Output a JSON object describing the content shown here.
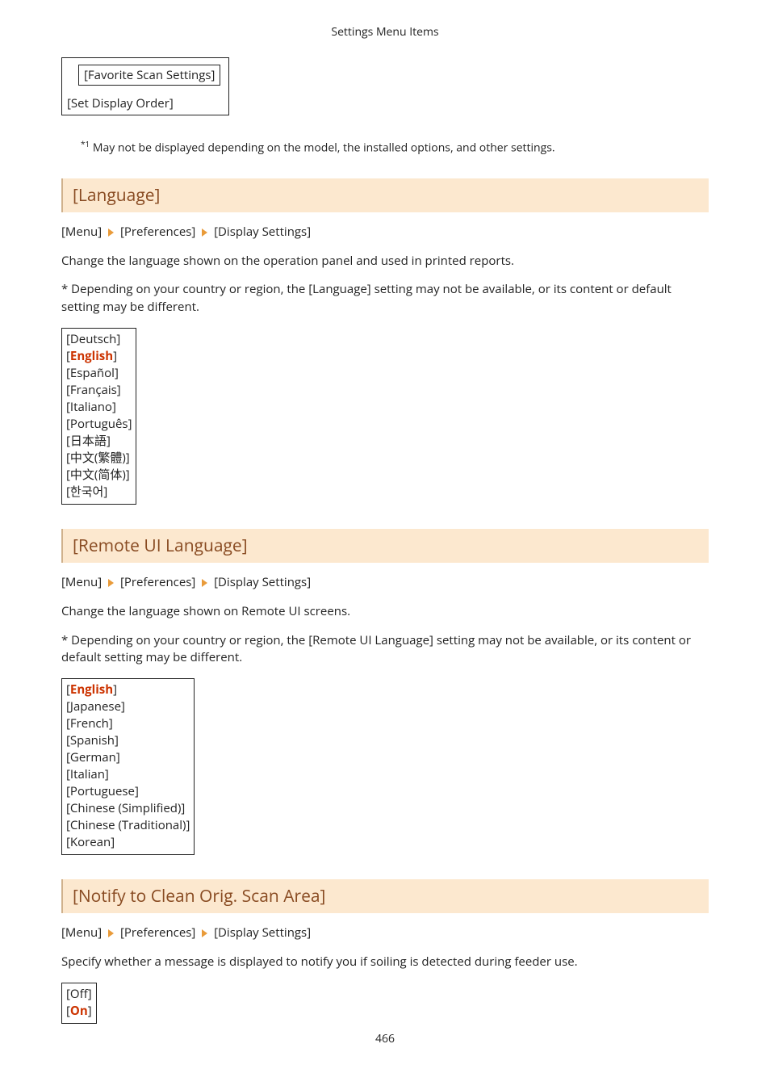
{
  "header": "Settings Menu Items",
  "topBox": {
    "inner": "[Favorite Scan Settings]",
    "outer": "[Set Display Order]"
  },
  "footnote": {
    "marker": "*1",
    "text": " May not be displayed depending on the model, the installed options, and other settings."
  },
  "breadcrumb": {
    "a": "[Menu]",
    "b": "[Preferences]",
    "c": "[Display Settings]"
  },
  "sections": {
    "language": {
      "title": "[Language]",
      "desc": "Change the language shown on the operation panel and used in printed reports.",
      "note": "* Depending on your country or region, the [Language] setting may not be available, or its content or default setting may be different.",
      "options": [
        {
          "pre": "[",
          "val": "Deutsch",
          "post": "]",
          "hl": false
        },
        {
          "pre": "[",
          "val": "English",
          "post": "]",
          "hl": true
        },
        {
          "pre": "[",
          "val": "Español",
          "post": "]",
          "hl": false
        },
        {
          "pre": "[",
          "val": "Français",
          "post": "]",
          "hl": false
        },
        {
          "pre": "[",
          "val": "Italiano",
          "post": "]",
          "hl": false
        },
        {
          "pre": "[",
          "val": "Português",
          "post": "]",
          "hl": false
        },
        {
          "pre": "[",
          "val": "日本語",
          "post": "]",
          "hl": false
        },
        {
          "pre": "[",
          "val": "中文(繁體)",
          "post": "]",
          "hl": false
        },
        {
          "pre": "[",
          "val": "中文(简体)",
          "post": "]",
          "hl": false
        },
        {
          "pre": "[",
          "val": "한국어",
          "post": "]",
          "hl": false
        }
      ]
    },
    "remote": {
      "title": "[Remote UI Language]",
      "desc": "Change the language shown on Remote UI screens.",
      "note": "* Depending on your country or region, the [Remote UI Language] setting may not be available, or its content or default setting may be different.",
      "options": [
        {
          "pre": "[",
          "val": "English",
          "post": "]",
          "hl": true
        },
        {
          "pre": "[",
          "val": "Japanese",
          "post": "]",
          "hl": false
        },
        {
          "pre": "[",
          "val": "French",
          "post": "]",
          "hl": false
        },
        {
          "pre": "[",
          "val": "Spanish",
          "post": "]",
          "hl": false
        },
        {
          "pre": "[",
          "val": "German",
          "post": "]",
          "hl": false
        },
        {
          "pre": "[",
          "val": "Italian",
          "post": "]",
          "hl": false
        },
        {
          "pre": "[",
          "val": "Portuguese",
          "post": "]",
          "hl": false
        },
        {
          "pre": "[",
          "val": "Chinese (Simplified)",
          "post": "]",
          "hl": false
        },
        {
          "pre": "[",
          "val": "Chinese (Traditional)",
          "post": "]",
          "hl": false
        },
        {
          "pre": "[",
          "val": "Korean",
          "post": "]",
          "hl": false
        }
      ]
    },
    "notify": {
      "title": "[Notify to Clean Orig. Scan Area]",
      "desc": "Specify whether a message is displayed to notify you if soiling is detected during feeder use.",
      "options": [
        {
          "pre": "[",
          "val": "Off",
          "post": "]",
          "hl": false
        },
        {
          "pre": "[",
          "val": "On",
          "post": "]",
          "hl": true
        }
      ]
    }
  },
  "pageNumber": "466"
}
